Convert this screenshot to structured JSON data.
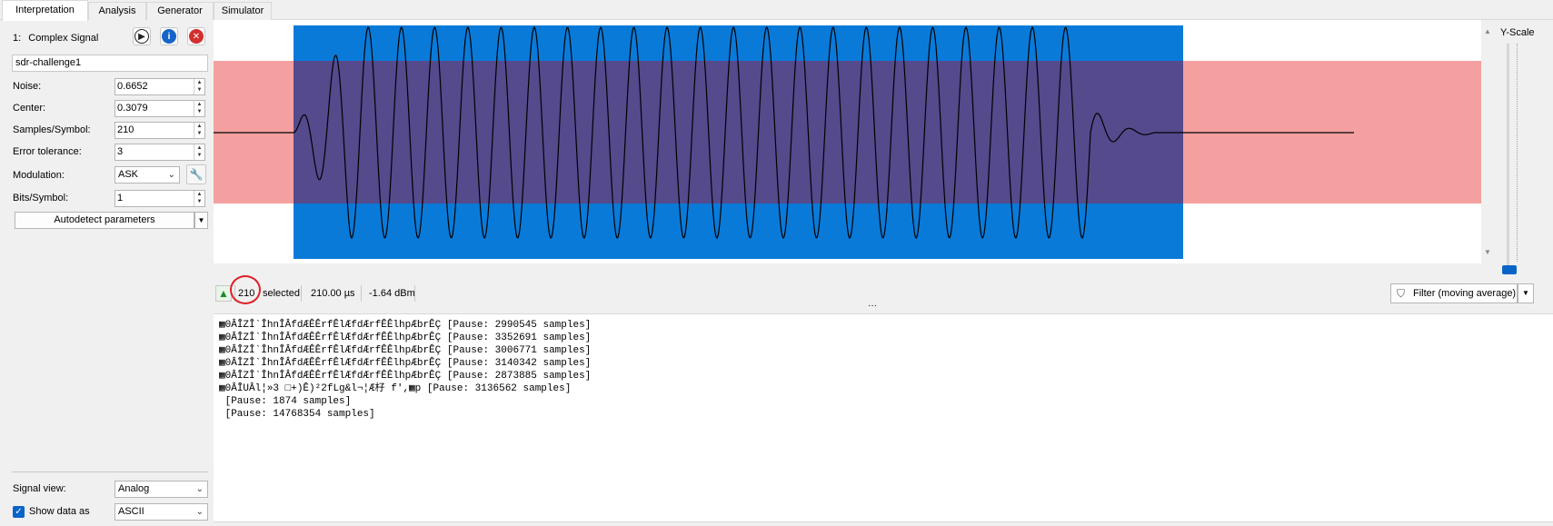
{
  "tabs": [
    "Interpretation",
    "Analysis",
    "Generator",
    "Simulator"
  ],
  "signal": {
    "index_label": "1:",
    "type_label": "Complex Signal",
    "name": "sdr-challenge1"
  },
  "params": {
    "noise_label": "Noise:",
    "noise_value": "0.6652",
    "center_label": "Center:",
    "center_value": "0.3079",
    "sps_label": "Samples/Symbol:",
    "sps_value": "210",
    "tolerance_label": "Error tolerance:",
    "tolerance_value": "3",
    "modulation_label": "Modulation:",
    "modulation_value": "ASK",
    "bits_label": "Bits/Symbol:",
    "bits_value": "1",
    "autodetect_label": "Autodetect parameters"
  },
  "bottom_panel": {
    "signal_view_label": "Signal view:",
    "signal_view_value": "Analog",
    "show_data_label": "Show data as",
    "show_data_value": "ASCII"
  },
  "graph": {
    "yscale_label": "Y-Scale",
    "noise_band_color": "#f4a0a0",
    "selection_color": "#0a7ad9",
    "overlap_color": "#544a8c",
    "wave_color": "#000000"
  },
  "status": {
    "selected_count": "210",
    "selected_label": "selected",
    "duration": "210.00 µs",
    "power": "-1.64 dBm",
    "filter_label": "Filter (moving average)"
  },
  "output_lines": [
    "▦0ÂÎZÎ`ÎhnÎÂfdÆÊÊrfÊlÆfdÆrfÊÊlhpÆbrÊÇ [Pause: 2990545 samples]",
    "▦0ÂÎZÎ`ÎhnÎÂfdÆÊÊrfÊlÆfdÆrfÊÊlhpÆbrÊÇ [Pause: 3352691 samples]",
    "▦0ÂÎZÎ`ÎhnÎÂfdÆÊÊrfÊlÆfdÆrfÊÊlhpÆbrÊÇ [Pause: 3006771 samples]",
    "▦0ÂÎZÎ`ÎhnÎÂfdÆÊÊrfÊlÆfdÆrfÊÊlhpÆbrÊÇ [Pause: 3140342 samples]",
    "▦0ÂÎZÎ`ÎhnÎÂfdÆÊÊrfÊlÆfdÆrfÊÊlhpÆbrÊÇ [Pause: 2873885 samples]",
    "▦0ÂÎUÂl¦»3 □+)Ê)²2fLg&l¬¦Æ杍 f',▦p [Pause: 3136562 samples]",
    " [Pause: 1874 samples]",
    " [Pause: 14768354 samples]"
  ]
}
